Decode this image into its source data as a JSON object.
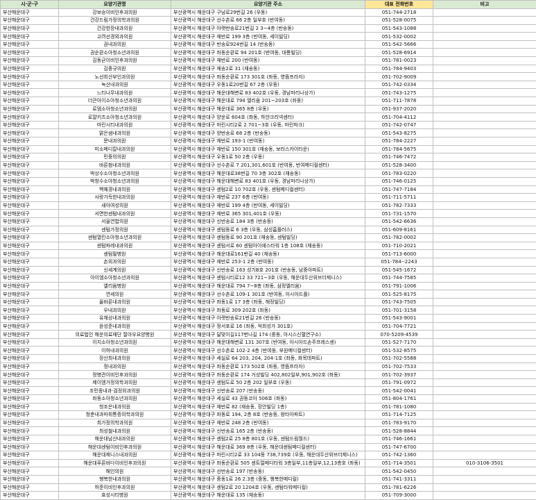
{
  "headers": {
    "region": "시·군·구",
    "name": "요양기관명",
    "address": "요양기관 주소",
    "phone": "대표 전화번호",
    "note": "비고"
  },
  "rows": [
    [
      "부산해운대구",
      "강보승이비인후과의원",
      "부산광역시 해운대구 구남로29번길 26 (우동)",
      "051-744-2718",
      ""
    ],
    [
      "부산해운대구",
      "건강드림가정의학과의원",
      "부산광역시 해운대구 선수촌로 66 2층 일부호 (반여동)",
      "051-528-0075",
      ""
    ],
    [
      "부산해운대구",
      "건강한장내과의원",
      "부산광역시 해운대구 아랫반송로21번길 2 3~4층 (반송동)",
      "051-543-1088",
      ""
    ],
    [
      "부산해운대구",
      "고려선경외과의원",
      "부산광역시 해운대구 재반로 199 3층 (반여동, 세이빌딩)",
      "051-532-0002",
      ""
    ],
    [
      "부산해운대구",
      "권내과의원",
      "부산광역시 해운대구 반송로924번길 14 (반송동)",
      "051-542-5666",
      ""
    ],
    [
      "부산해운대구",
      "권순환소아청소년과의원",
      "부산광역시 해운대구 좌동순환로 94 201호 (반여동, 대룡빌딩)",
      "051-528-6914",
      ""
    ],
    [
      "부산해운대구",
      "김동균이비인후과의원",
      "부산광역시 해운대구 재반로 200 (반여동)",
      "051-781-0023",
      ""
    ],
    [
      "부산해운대구",
      "김중규의원",
      "부산광역시 해운대구 재송2로 31 (재송동)",
      "051-784-9403",
      ""
    ],
    [
      "부산해운대구",
      "노선희산부인과의원",
      "부산광역시 해운대구 좌동순환로 173 301호 (좌동, 영뜸프라자)",
      "051-702-9009",
      ""
    ],
    [
      "부산해운대구",
      "녹산내과의원",
      "부산광역시 해운대구 우동1로20번길 67 2층 (우동)",
      "051-742-0334",
      ""
    ],
    [
      "부산해운대구",
      "느티나무내과의원",
      "부산광역시 해운대구 해운대해변로 83 402호 (우동, 경남마리나상가)",
      "051-743-1275",
      ""
    ],
    [
      "부산해운대구",
      "더큰아이소아청소년과의원",
      "부산광역시 해운대구 해운대로 794 엘리움 201~203호 (좌동)",
      "051-711-7878",
      ""
    ],
    [
      "부산해운대구",
      "로뎀소아청소년과의원",
      "부산광역시 해운대구 해운대로 365 8층 (우동)",
      "051-937-2020",
      ""
    ],
    [
      "부산해운대구",
      "로얄키즈소아청소년과의원",
      "부산광역시 해운대구 양운로 604호 (좌동, 하얀크리넥센터)",
      "051-704-4112",
      ""
    ],
    [
      "부산해운대구",
      "마린시티내과의원",
      "부산광역시 해운대구 마린시티2로 2 701~3호 (우동, 마린파크)",
      "051-742-0747",
      ""
    ],
    [
      "부산해운대구",
      "맑은샘내과의원",
      "부산광역시 해운대구 양반송로 68 2층 (반송동)",
      "051-543-8275",
      ""
    ],
    [
      "부산해운대구",
      "문내과의원",
      "부산광역시 해운대구 재반로 193-1 (반여동)",
      "051-784-2227",
      ""
    ],
    [
      "부산해운대구",
      "미소메디칼내과의원",
      "부산광역시 해운대구 재반로 150 301호 (재송동, 보러스카이타운)",
      "051-784-5675",
      ""
    ],
    [
      "부산해운대구",
      "민중의의원",
      "부산광역시 해운대구 우동1로 50 2층 (우동)",
      "051-746-7472",
      ""
    ],
    [
      "부산해운대구",
      "바른첨내과의원",
      "부산광역시 해운대구 선수촌로 7 201,301,601호 (반여동, 반여메디컬센터)",
      "051-528-3400",
      ""
    ],
    [
      "부산해운대구",
      "박상수소아청소년과의원",
      "부산광역시 해운대구 해운대로38번길 70 3층 302호 (재송동)",
      "051-783-0220",
      ""
    ],
    [
      "부산해운대구",
      "박창수소아청소년과의원",
      "부산광역시 해운대구 해운대해변로 83 401호 (우동, 경남마리나상가)",
      "051-746-0125",
      ""
    ],
    [
      "부산해운대구",
      "백혜경내과의원",
      "부산광역시 해운대구 센텀2로 10 702호 (우동, 센텀메디컬센터)",
      "051-747-7184",
      ""
    ],
    [
      "부산해운대구",
      "사랑가득한내과의원",
      "부산광역시 해운대구 재반로 237 6층 (반여동)",
      "051-711-5711",
      ""
    ],
    [
      "부산해운대구",
      "새아여성의원",
      "부산광역시 해운대구 재반로 199 4층 (반여동, 세이빌딩)",
      "051-782-7333",
      ""
    ],
    [
      "부산해운대구",
      "서면한센텀내과의원",
      "부산광역시 해운대구 재반로 365 301,401호 (우동)",
      "051-731-1570",
      ""
    ],
    [
      "부산해운대구",
      "서울연합의원",
      "부산광역시 해운대구 신반송로 184 3층 (반송동)",
      "051-542-6636",
      ""
    ],
    [
      "부산해운대구",
      "센텀가정의원",
      "부산광역시 해운대구 센텀동로 6 3층 (우동, 삼성홈플러스)",
      "051-609-8161",
      ""
    ],
    [
      "부산해운대구",
      "센텀열린소아청소년과의원",
      "부산광역시 해운대구 센텀동로 90 201호 (재송동, 센텀빌딩)",
      "051-782-0002",
      ""
    ],
    [
      "부산해운대구",
      "센텀파레내과의원",
      "부산광역시 해운대구 센텀서로 60 센텀아이에스타워 1층 108호 (재송동)",
      "051-710-2021",
      ""
    ],
    [
      "부산해운대구",
      "센텀필병원",
      "부산광역시 해운대구 해운대로161번길 40 (재송동)",
      "051-713-6000",
      ""
    ],
    [
      "부산해운대구",
      "손외과의원",
      "부산광역시 해운대구 재반로 253-1 2층 (반여동)",
      "051-784--2243",
      ""
    ],
    [
      "부산해운대구",
      "신세계의원",
      "부산광역시 해운대구 신반송로 163 성기B호 201호 (반송동, 남중아파트)",
      "051-545-1672",
      ""
    ],
    [
      "부산해운대구",
      "아이엠소아청소년과의원",
      "부산광역시 해운대구 센텀시티로12 33 721~3호 (우동, 해운대두산위브더제니스)",
      "051-744-7585",
      ""
    ],
    [
      "부산해운대구",
      "앨리움병원",
      "부산광역시 해운대구 해운대로 794 7~8층 (좌동, 삼정엘리움)",
      "051-791-1006",
      ""
    ],
    [
      "부산해운대구",
      "연세의원",
      "부산광역시 해운대구 선수촌로 109-1 301호 (반여동, 아시아드플)",
      "051-525-8175",
      ""
    ],
    [
      "부산해운대구",
      "올바른내과의원",
      "부산광역시 해운대구 좌동1로 17 3층 (좌동, 해정빌딩)",
      "051-743-7505",
      ""
    ],
    [
      "부산해운대구",
      "우내과의원",
      "부산광역시 해운대구 좌동로 309 202호 (좌동)",
      "051-701-3158",
      ""
    ],
    [
      "부산해운대구",
      "유채상내과의원",
      "부산광역시 해운대구 아랫반송로21번길 26 (반송동)",
      "051-543-9001",
      ""
    ],
    [
      "부산해운대구",
      "윤성준내과의원",
      "부산광역시 해운대구 정서포로 16 (좌동, 억희성가 301호)",
      "051-704-7721",
      ""
    ],
    [
      "부산해운대구",
      "의료법인 해운의료재단 절아우요양병원",
      "부산광역시 해운대구 달맞이길117번나길 174 (중동, 아시스신혈연구소)",
      "070-5209-4539",
      ""
    ],
    [
      "부산해운대구",
      "이지소아청소년과의원",
      "부산광역시 해운대구 해운대해변로 131 307호 (반여동, 아시아드손주프레스센)",
      "051-527-7170",
      ""
    ],
    [
      "부산해운대구",
      "이하내과의원",
      "부산광역시 해운대구 선수촌로 102-2 4층 (반여동, 부원메디컬센터)",
      "051-532-8575",
      ""
    ],
    [
      "부산해운대구",
      "장산최내과의원",
      "부산광역시 해운대구 세실로 64 203, 204, 204-1호 (좌동, 화목데파트)",
      "051-702-5588",
      ""
    ],
    [
      "부산해운대구",
      "정내과의원",
      "부산광역시 해운대구 좌동순환로 173 502호 (좌동, 영뜸프라자)",
      "051-702-7533",
      ""
    ],
    [
      "부산해운대구",
      "정병관이비인후과의원",
      "부산광역시 해운대구 좌동순환로 174 거성빌딩 402,802일부,901,902호 (좌동)",
      "051-702-3937",
      ""
    ],
    [
      "부산해운대구",
      "제이엠가정의학과의원",
      "부산광역시 해운대구 센텀도로 50 2층 202 일부호 (우동)",
      "051-791-0972",
      ""
    ],
    [
      "부산해운대구",
      "조민종내과·검정외과의원",
      "부산광역시 해운대구 신반송로 207 (반송동)",
      "051-542-0041",
      ""
    ],
    [
      "부산해운대구",
      "좌동소아청소년과의원",
      "부산광역시 해운대구 세실로 43 권동코아 506호 (좌동)",
      "051-804-1761",
      ""
    ],
    [
      "부산해운대구",
      "청조은내과의원",
      "부산광역시 해운대구 재반로 82 (재송동, 장안빌딩 1층)",
      "051-781-1080",
      ""
    ],
    [
      "부산해운대구",
      "청춘내과마취통증의학과의원",
      "부산광역시 해운대구 좌동로 194, 2층 8호 (반송동, 왕타아파트)",
      "051-714-7125",
      ""
    ],
    [
      "부산해운대구",
      "최가정의학과의원",
      "부산광역시 해운대구 재반로 248 2층 (반여동)",
      "051-783-9170",
      ""
    ],
    [
      "부산해운대구",
      "최성철내과의원",
      "부산광역시 해운대구 신반송로 165 2층 (반송동)",
      "051-528-8844",
      ""
    ],
    [
      "부산해운대구",
      "해운대남산내과의원",
      "부산광역시 해운대구 센텀2로 25 8층 801호 (우동, 센텀드림월드)",
      "051-746-1661",
      ""
    ],
    [
      "부산해운대구",
      "해운대센텀이비인후과의원",
      "부산광역시 해운대구 해운대로 369 8층 (우동, 해운대센텀메디컬센터)",
      "051-747-6700",
      ""
    ],
    [
      "부산해운대구",
      "해운대제니스내과의원",
      "부산광역시 해운대구 마린시티2로 33 104동 738,739호 (우동, 해운대두산위브더제니스)",
      "051-742-1360",
      ""
    ],
    [
      "부산해운대구",
      "해운대푸른바다이비인후과의원",
      "부산광역시 해운대구 좌동순환로 505 센트럴메디타워 3층일부,11층일부,12,13층호 (좌동)",
      "051-714-3501",
      "010-3106-3501"
    ],
    [
      "부산해운대구",
      "해인의원",
      "부산광역시 해운대구 선반송로 197 (반송동)",
      "051-542-0450",
      ""
    ],
    [
      "부산해운대구",
      "행복한내과의원",
      "부산광역시 해운대구 중동1로 26 2.3층 (중동, 행복한메디컬)",
      "051-741-3311",
      ""
    ],
    [
      "부산해운대구",
      "허준이비인후과의원",
      "부산광역시 해운대구 센텀2로 20 1204호 (우동, 센텀타워메디컬)",
      "051-781-6226",
      ""
    ],
    [
      "부산해운대구",
      "효성시티병원",
      "부산광역시 해운대구 해운대로 135 (재송동)",
      "051-709-3000",
      ""
    ]
  ]
}
